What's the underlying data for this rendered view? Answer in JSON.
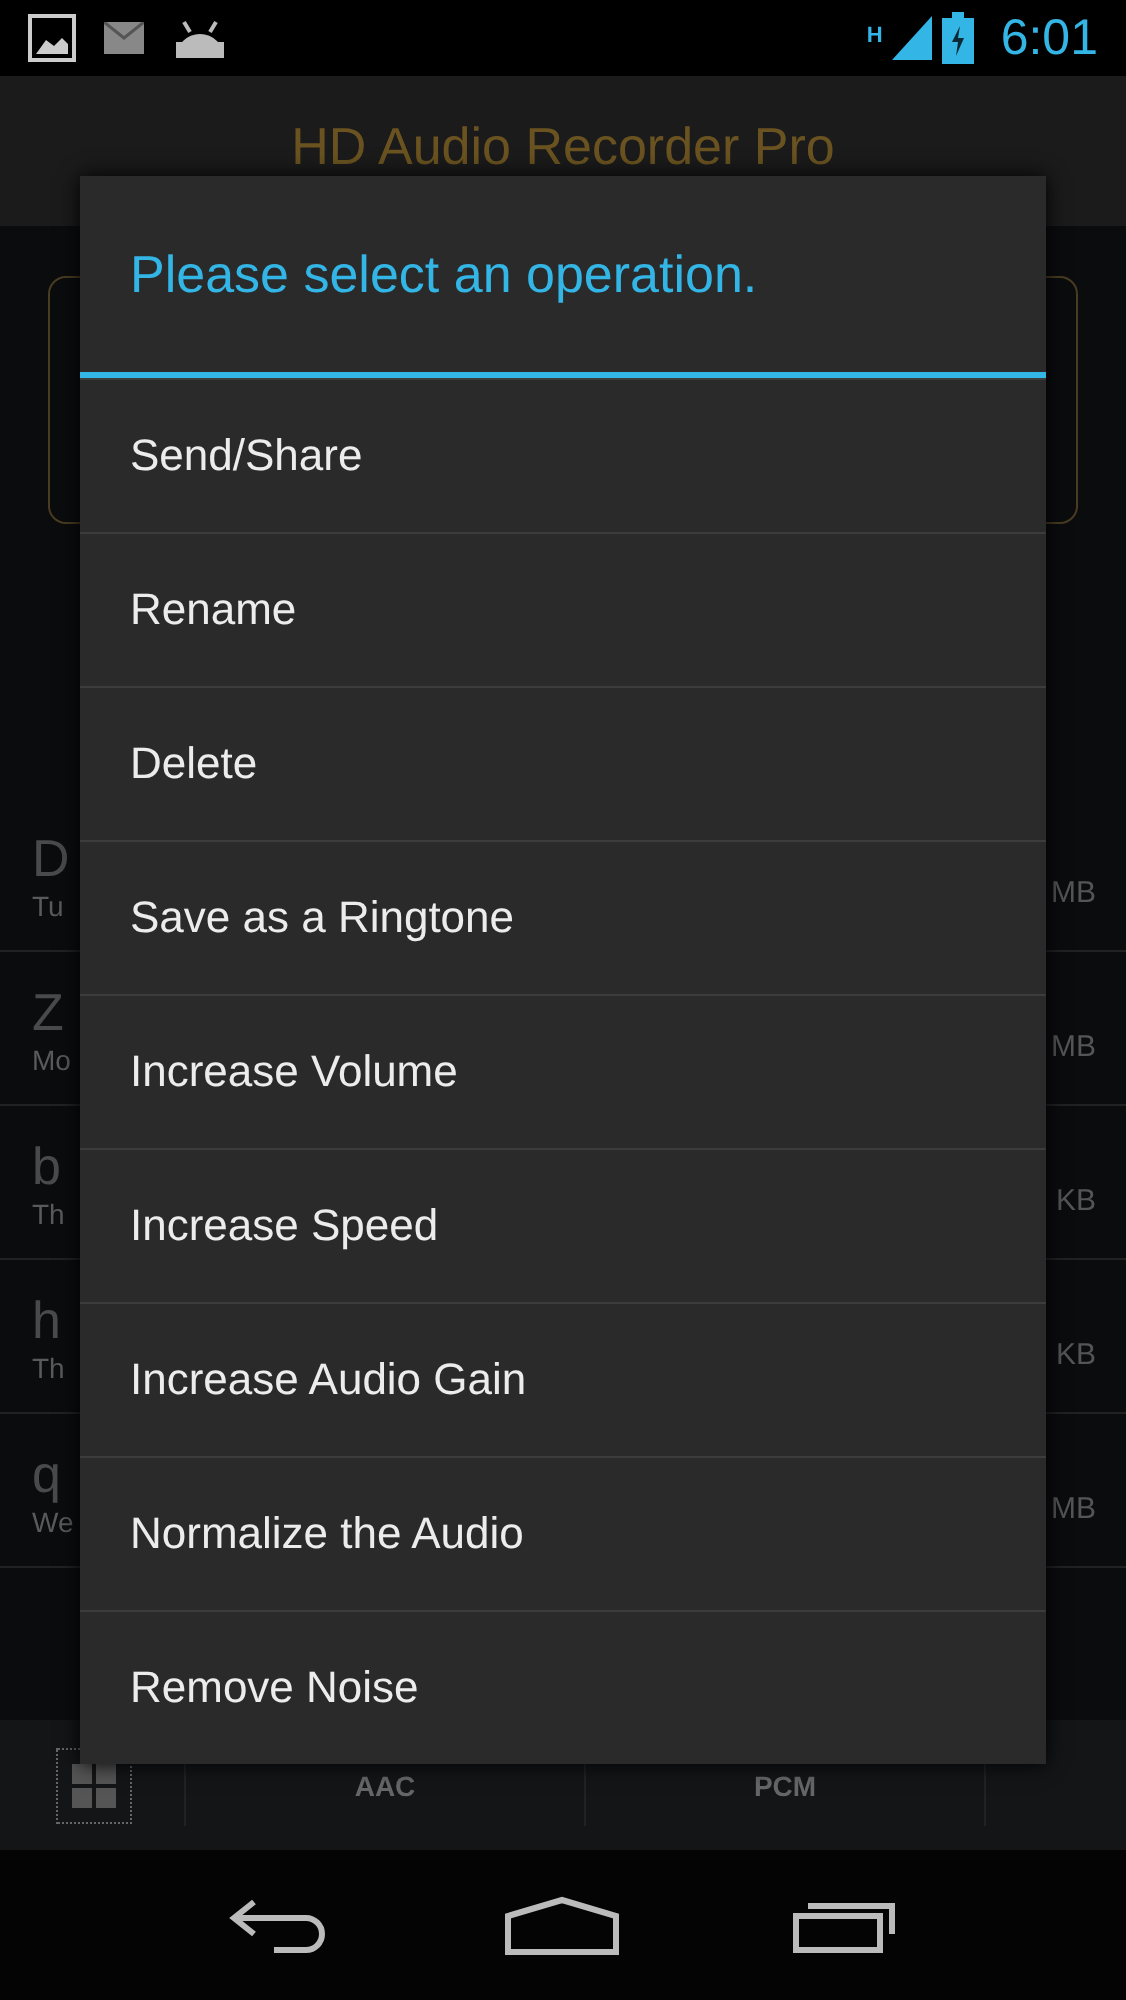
{
  "status_bar": {
    "time": "6:01",
    "network": "H"
  },
  "app_bar": {
    "title": "HD Audio Recorder Pro"
  },
  "recordings": [
    {
      "name": "D",
      "date": "Tu",
      "size": "MB"
    },
    {
      "name": "Z",
      "date": "Mo",
      "size": "MB"
    },
    {
      "name": "b",
      "date": "Th",
      "size": "KB"
    },
    {
      "name": "h",
      "date": "Th",
      "size": "KB"
    },
    {
      "name": "q",
      "date": "We",
      "size": "MB"
    }
  ],
  "toolbar": {
    "formats": [
      "AAC",
      "PCM"
    ]
  },
  "dialog": {
    "title": "Please select an operation.",
    "options": [
      "Send/Share",
      "Rename",
      "Delete",
      "Save as a Ringtone",
      "Increase Volume",
      "Increase Speed",
      "Increase Audio Gain",
      "Normalize the Audio",
      "Remove Noise"
    ]
  }
}
